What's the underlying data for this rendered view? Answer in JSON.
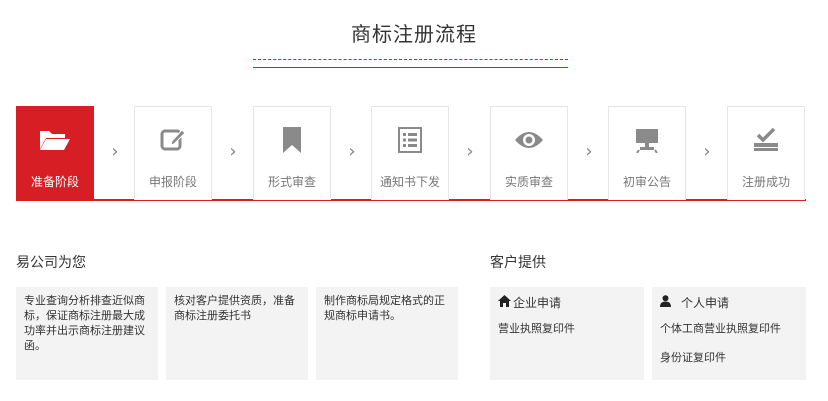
{
  "page": {
    "title": "商标注册流程"
  },
  "steps": [
    {
      "label": "准备阶段",
      "icon": "folder-open-icon",
      "active": true
    },
    {
      "label": "申报阶段",
      "icon": "edit-icon",
      "active": false
    },
    {
      "label": "形式审查",
      "icon": "bookmark-icon",
      "active": false
    },
    {
      "label": "通知书下发",
      "icon": "list-document-icon",
      "active": false
    },
    {
      "label": "实质审查",
      "icon": "eye-icon",
      "active": false
    },
    {
      "label": "初审公告",
      "icon": "monitor-icon",
      "active": false
    },
    {
      "label": "注册成功",
      "icon": "check-stamp-icon",
      "active": false
    }
  ],
  "colors": {
    "accent": "#d81e25",
    "inactive_icon": "#8a8a8a",
    "box_bg": "#f3f3f3"
  },
  "company": {
    "heading": "易公司为您",
    "boxes": [
      "专业查询分析排查近似商标，保证商标注册最大成功率并出示商标注册建议函。",
      "核对客户提供资质，准备商标注册委托书",
      "制作商标局规定格式的正规商标申请书。"
    ]
  },
  "customer": {
    "heading": "客户提供",
    "enterprise": {
      "title": "企业申请",
      "icon": "home-icon",
      "items": [
        "营业执照复印件"
      ]
    },
    "personal": {
      "title": "个人申请",
      "icon": "user-icon",
      "items": [
        "个体工商营业执照复印件",
        "身份证复印件"
      ]
    }
  }
}
